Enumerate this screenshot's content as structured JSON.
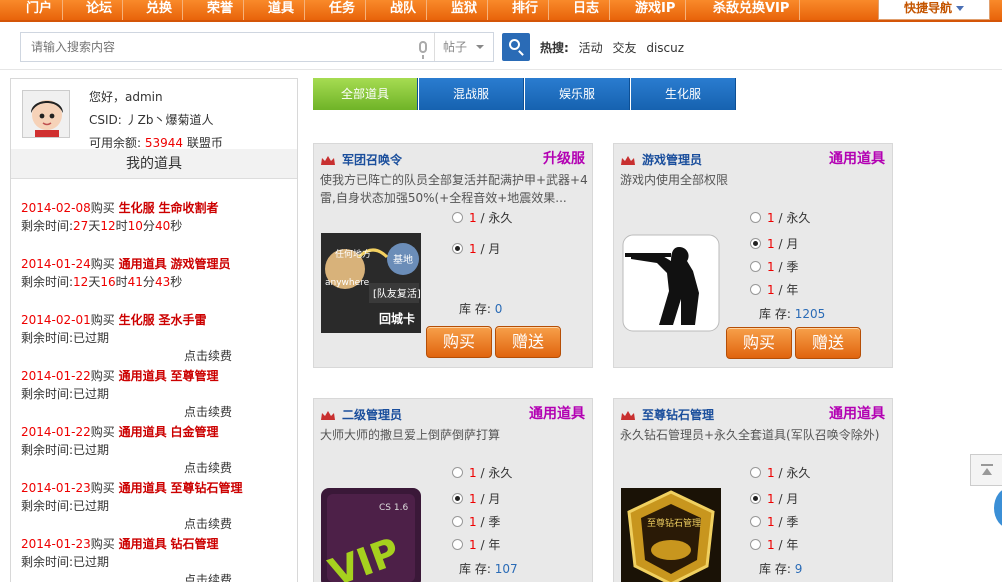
{
  "nav": {
    "items": [
      "门户",
      "论坛",
      "兑换",
      "荣誉",
      "道具",
      "任务",
      "战队",
      "监狱",
      "排行",
      "日志",
      "游戏IP",
      "杀敌兑换VIP"
    ],
    "quick_nav": "快捷导航"
  },
  "search": {
    "placeholder": "请输入搜索内容",
    "type": "帖子",
    "hot_label": "热搜:",
    "hot_terms": [
      "活动",
      "交友",
      "discuz"
    ]
  },
  "user": {
    "greeting": "您好，admin",
    "csid": "CSID: 丿Zb丶爆菊道人",
    "balance_label": "可用余额:",
    "balance_value": "53944",
    "balance_unit": "联盟币"
  },
  "my_items": {
    "title": "我的道具",
    "remain_label": "剩余时间:",
    "renew_label": "点击续费",
    "expired_label": "已过期",
    "records": [
      {
        "date": "2014-02-08",
        "buy": "购买",
        "server": "生化服",
        "item": "生命收割者",
        "remaining": {
          "d": "27",
          "h": "12",
          "m": "10",
          "s": "40"
        }
      },
      {
        "date": "2014-01-24",
        "buy": "购买",
        "server": "通用道具",
        "item": "游戏管理员",
        "remaining": {
          "d": "12",
          "h": "16",
          "m": "41",
          "s": "43"
        }
      },
      {
        "date": "2014-02-01",
        "buy": "购买",
        "server": "生化服",
        "item": "圣水手雷",
        "expired": true
      },
      {
        "date": "2014-01-22",
        "buy": "购买",
        "server": "通用道具",
        "item": "至尊管理",
        "expired": true
      },
      {
        "date": "2014-01-22",
        "buy": "购买",
        "server": "通用道具",
        "item": "白金管理",
        "expired": true
      },
      {
        "date": "2014-01-23",
        "buy": "购买",
        "server": "通用道具",
        "item": "至尊钻石管理",
        "expired": true
      },
      {
        "date": "2014-01-23",
        "buy": "购买",
        "server": "通用道具",
        "item": "钻石管理",
        "expired": true
      }
    ],
    "units": {
      "d": "天",
      "h": "时",
      "m": "分",
      "s": "秒"
    }
  },
  "tabs": [
    "全部道具",
    "混战服",
    "娱乐服",
    "生化服"
  ],
  "cards": [
    {
      "name": "军团召唤令",
      "category": "升级服",
      "desc": "使我方已阵亡的队员全部复活并配满护甲+武器+4雷,自身状态加强50%(+全程音效+地震效果...",
      "image_text": [
        "任何地方",
        "anywhere",
        "基地",
        "[队友复活]",
        "回城卡"
      ],
      "options": [
        {
          "n": "1",
          "unit": "/ 永久",
          "checked": false
        },
        {
          "n": "1",
          "unit": "/ 月",
          "checked": true
        }
      ],
      "stock_label": "库  存:",
      "stock": "0"
    },
    {
      "name": "游戏管理员",
      "category": "通用道具",
      "desc": "游戏内使用全部权限",
      "options": [
        {
          "n": "1",
          "unit": "/ 永久",
          "checked": false
        },
        {
          "n": "1",
          "unit": "/ 月",
          "checked": true
        },
        {
          "n": "1",
          "unit": "/ 季",
          "checked": false
        },
        {
          "n": "1",
          "unit": "/ 年",
          "checked": false
        }
      ],
      "stock_label": "库  存:",
      "stock": "1205"
    },
    {
      "name": "二级管理员",
      "category": "通用道具",
      "desc": "大师大师的撒旦爱上倒萨倒萨打算",
      "image_text": [
        "CS 1.6",
        "VIP"
      ],
      "options": [
        {
          "n": "1",
          "unit": "/ 永久",
          "checked": false
        },
        {
          "n": "1",
          "unit": "/ 月",
          "checked": true
        },
        {
          "n": "1",
          "unit": "/ 季",
          "checked": false
        },
        {
          "n": "1",
          "unit": "/ 年",
          "checked": false
        }
      ],
      "stock_label": "库  存:",
      "stock": "107"
    },
    {
      "name": "至尊钻石管理",
      "category": "通用道具",
      "desc": "永久钻石管理员+永久全套道具(军队召唤令除外)",
      "image_text": [
        "至尊钻石管理"
      ],
      "options": [
        {
          "n": "1",
          "unit": "/ 永久",
          "checked": false
        },
        {
          "n": "1",
          "unit": "/ 月",
          "checked": true
        },
        {
          "n": "1",
          "unit": "/ 季",
          "checked": false
        },
        {
          "n": "1",
          "unit": "/ 年",
          "checked": false
        }
      ],
      "stock_label": "库  存:",
      "stock": "9"
    }
  ],
  "buttons": {
    "buy": "购买",
    "gift": "赠送"
  },
  "colors": {
    "nav_orange": "#f07818",
    "tab_blue": "#1a6ec0",
    "tab_green": "#8cc83c",
    "category_purple": "#b300b3",
    "price_red": "#e00000"
  }
}
